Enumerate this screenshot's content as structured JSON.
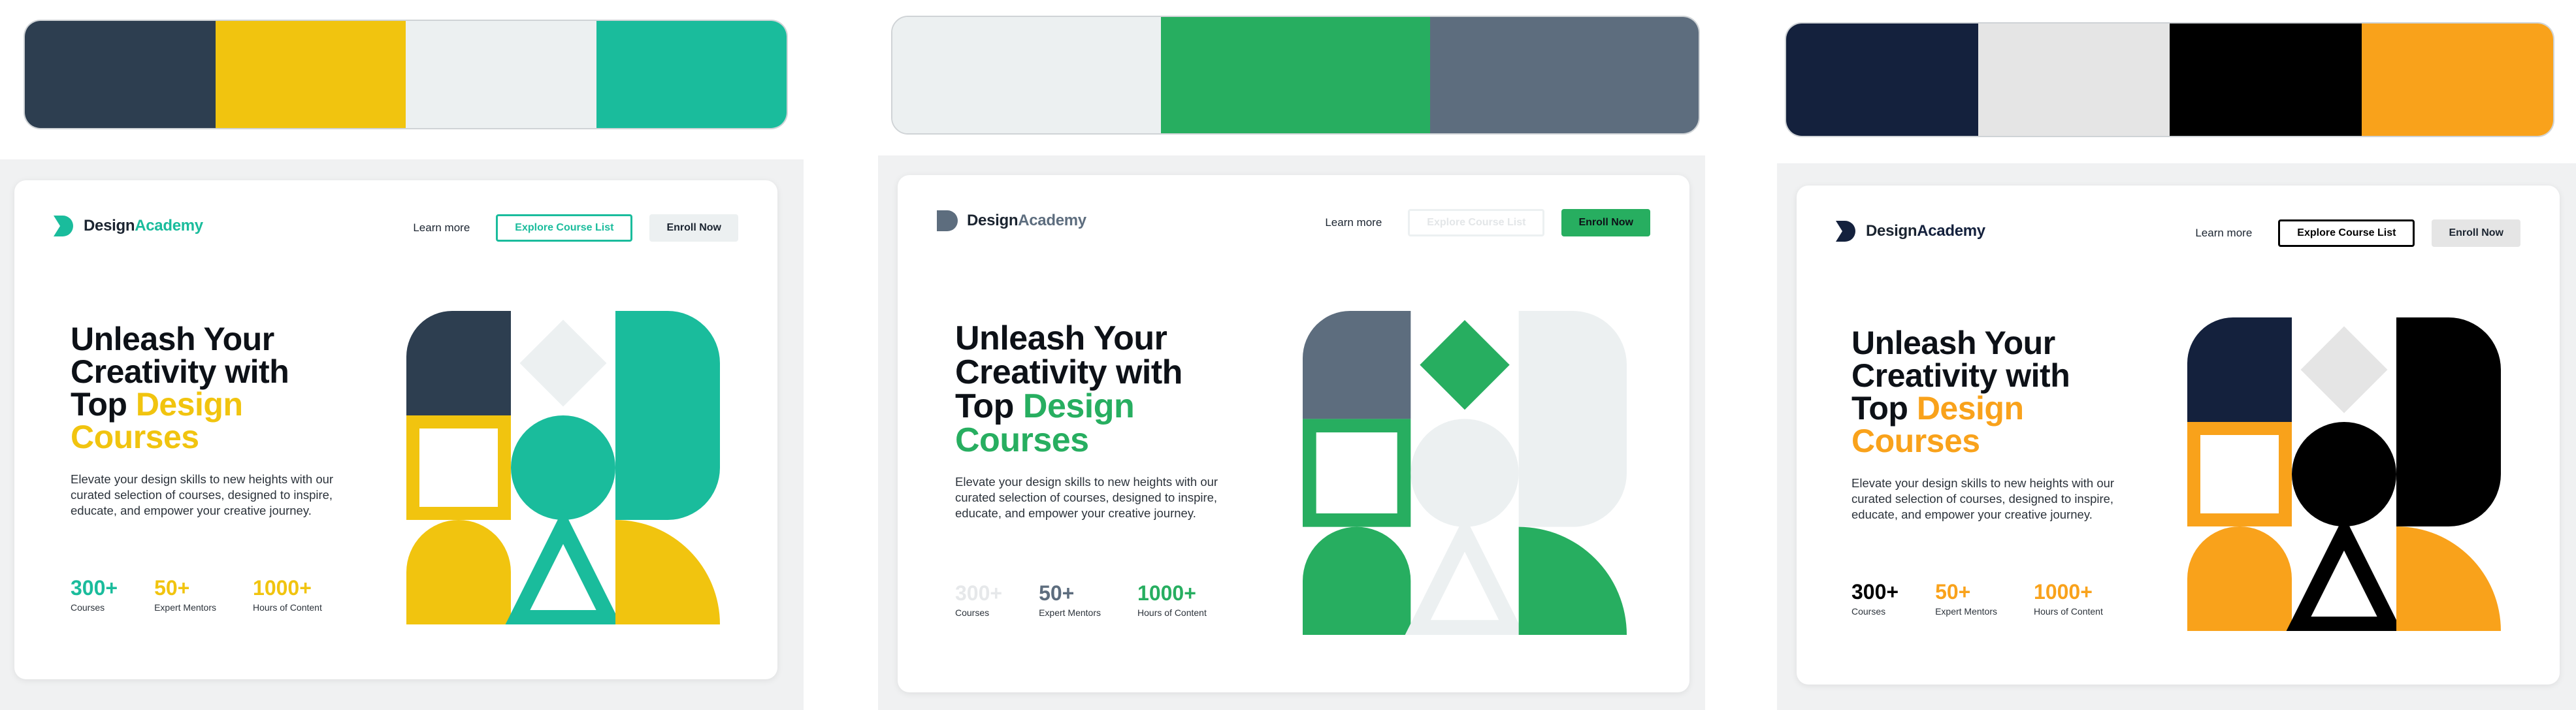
{
  "variants": [
    {
      "palette": [
        "#2d3e50",
        "#f1c40f",
        "#ecf0f1",
        "#1abc9c"
      ],
      "brand": {
        "part1": "Design",
        "part2": "Academy",
        "accent": "#1abc9c"
      },
      "nav": {
        "learn_more": "Learn more",
        "explore": "Explore Course List",
        "enroll": "Enroll Now"
      },
      "headline": {
        "line1": "Unleash Your",
        "line2": "Creativity with",
        "line3_plain": "Top ",
        "line3_accent": "Design",
        "line4_accent": "Courses",
        "accent": "#f1c40f"
      },
      "description": "Elevate your design skills to new heights with our curated selection of courses, designed to inspire, educate, and empower your creative journey.",
      "stats": [
        {
          "value": "300+",
          "label": "Courses",
          "color": "#1abc9c"
        },
        {
          "value": "50+",
          "label": "Expert Mentors",
          "color": "#f1c40f"
        },
        {
          "value": "1000+",
          "label": "Hours of Content",
          "color": "#f1c40f"
        }
      ]
    },
    {
      "palette": [
        "#ecf0f1",
        "#27ae60",
        "#5d6d7e"
      ],
      "brand": {
        "part1": "Design",
        "part2": "Academy",
        "accent": "#5d6d7e"
      },
      "nav": {
        "learn_more": "Learn more",
        "explore": "Explore Course List",
        "enroll": "Enroll Now"
      },
      "headline": {
        "line1": "Unleash Your",
        "line2": "Creativity with",
        "line3_plain": "Top ",
        "line3_accent": "Design",
        "line4_accent": "Courses",
        "accent": "#27ae60"
      },
      "description": "Elevate your design skills to new heights with our curated selection of courses, designed to inspire, educate, and empower your creative journey.",
      "stats": [
        {
          "value": "300+",
          "label": "Courses",
          "color": "#e6e8ea"
        },
        {
          "value": "50+",
          "label": "Expert Mentors",
          "color": "#5d6d7e"
        },
        {
          "value": "1000+",
          "label": "Hours of Content",
          "color": "#27ae60"
        }
      ]
    },
    {
      "palette": [
        "#14213d",
        "#e5e5e5",
        "#000000",
        "#f9a21b"
      ],
      "brand": {
        "part1": "Design",
        "part2": "Academy",
        "accent": "#14213d"
      },
      "nav": {
        "learn_more": "Learn more",
        "explore": "Explore Course List",
        "enroll": "Enroll Now"
      },
      "headline": {
        "line1": "Unleash Your",
        "line2": "Creativity with",
        "line3_plain": "Top ",
        "line3_accent": "Design",
        "line4_accent": "Courses",
        "accent": "#f9a21b"
      },
      "description": "Elevate your design skills to new heights with our curated selection of courses, designed to inspire, educate, and empower your creative journey.",
      "stats": [
        {
          "value": "300+",
          "label": "Courses",
          "color": "#000000"
        },
        {
          "value": "50+",
          "label": "Expert Mentors",
          "color": "#f9a21b"
        },
        {
          "value": "1000+",
          "label": "Hours of Content",
          "color": "#f9a21b"
        }
      ]
    }
  ]
}
